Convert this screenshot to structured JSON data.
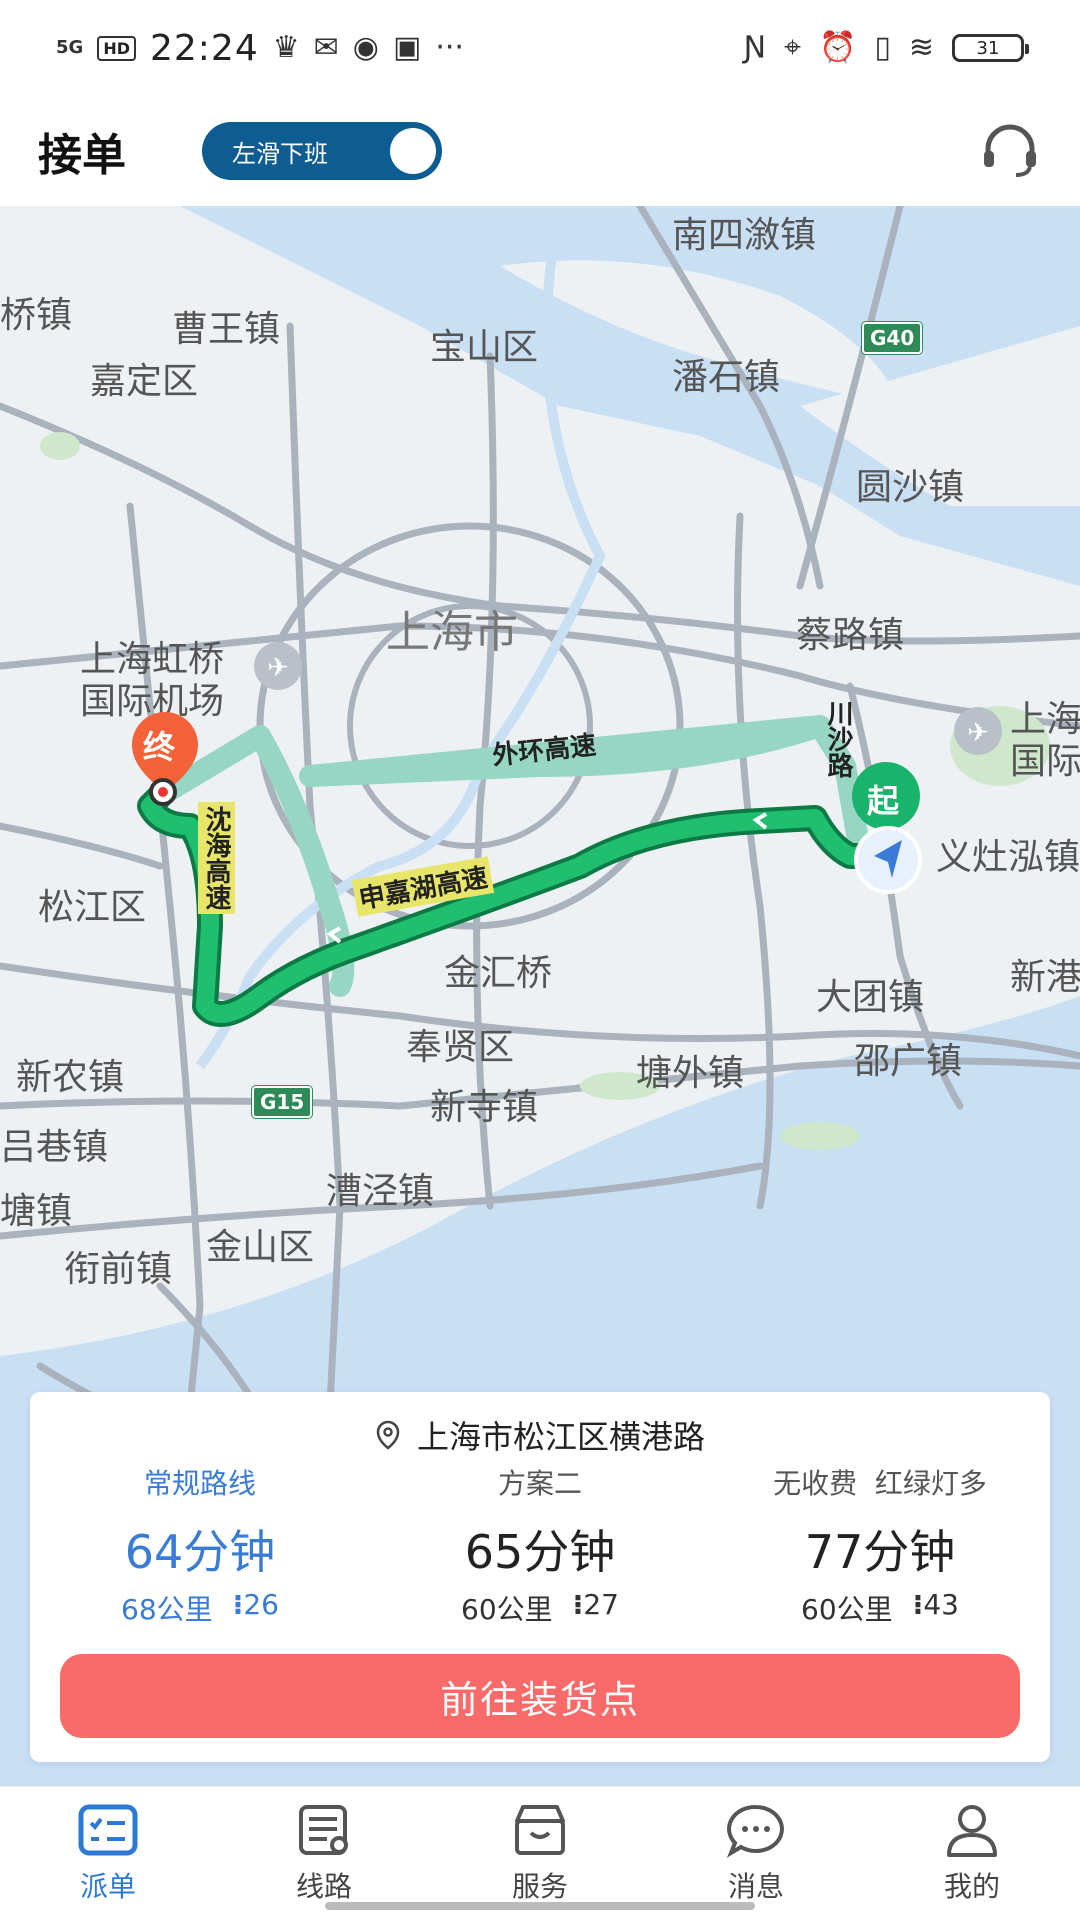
{
  "status_bar": {
    "signal": "5G",
    "hd": "HD",
    "time": "22:24",
    "more": "···",
    "battery": "31"
  },
  "header": {
    "title": "接单",
    "toggle_label": "左滑下班"
  },
  "map": {
    "labels": {
      "nansixu": "南四漵镇",
      "qiao": "桥镇",
      "caowang": "曹王镇",
      "baoshan": "宝山区",
      "panshi": "潘石镇",
      "jiading": "嘉定区",
      "yuansha": "圆沙镇",
      "shanghai": "上海市",
      "hongqiao": "上海虹桥",
      "hongqiao2": "国际机场",
      "cailu": "蔡路镇",
      "shanghai_r": "上海",
      "guoji_r": "国际",
      "yizao": "义灶泓镇",
      "songjiang": "松江区",
      "jinhui": "金汇桥",
      "xingang": "新港",
      "datuan": "大团镇",
      "fengxian": "奉贤区",
      "tangwai": "塘外镇",
      "shaoguang": "邵广镇",
      "xinnong": "新农镇",
      "xinsi": "新寺镇",
      "lvxiang": "吕巷镇",
      "caojing": "漕泾镇",
      "tang": "塘镇",
      "jinshan": "金山区",
      "jieqian": "衔前镇"
    },
    "roads": {
      "waihuan": "外环高速",
      "shenjiahu": "申嘉湖高速",
      "shenhai": "沈海高速",
      "chuansha": "川沙路"
    },
    "shields": {
      "g40": "G40",
      "g15": "G15"
    },
    "markers": {
      "end": "终",
      "start": "起"
    }
  },
  "route_card": {
    "destination": "上海市松江区横港路",
    "plans": [
      {
        "name": "常规路线",
        "time": "64分钟",
        "distance": "68公里",
        "lights": "26"
      },
      {
        "name": "方案二",
        "time": "65分钟",
        "distance": "60公里",
        "lights": "27"
      },
      {
        "name": "无收费  红绿灯多",
        "time": "77分钟",
        "distance": "60公里",
        "lights": "43"
      }
    ],
    "cta": "前往装货点"
  },
  "nav": [
    {
      "label": "派单"
    },
    {
      "label": "线路"
    },
    {
      "label": "服务"
    },
    {
      "label": "消息"
    },
    {
      "label": "我的"
    }
  ],
  "colors": {
    "route_primary": "#1fbf6f",
    "route_alt": "#96d6c3",
    "cta": "#f96a69",
    "active_blue": "#3a7bd5",
    "toggle": "#0d5d93"
  }
}
